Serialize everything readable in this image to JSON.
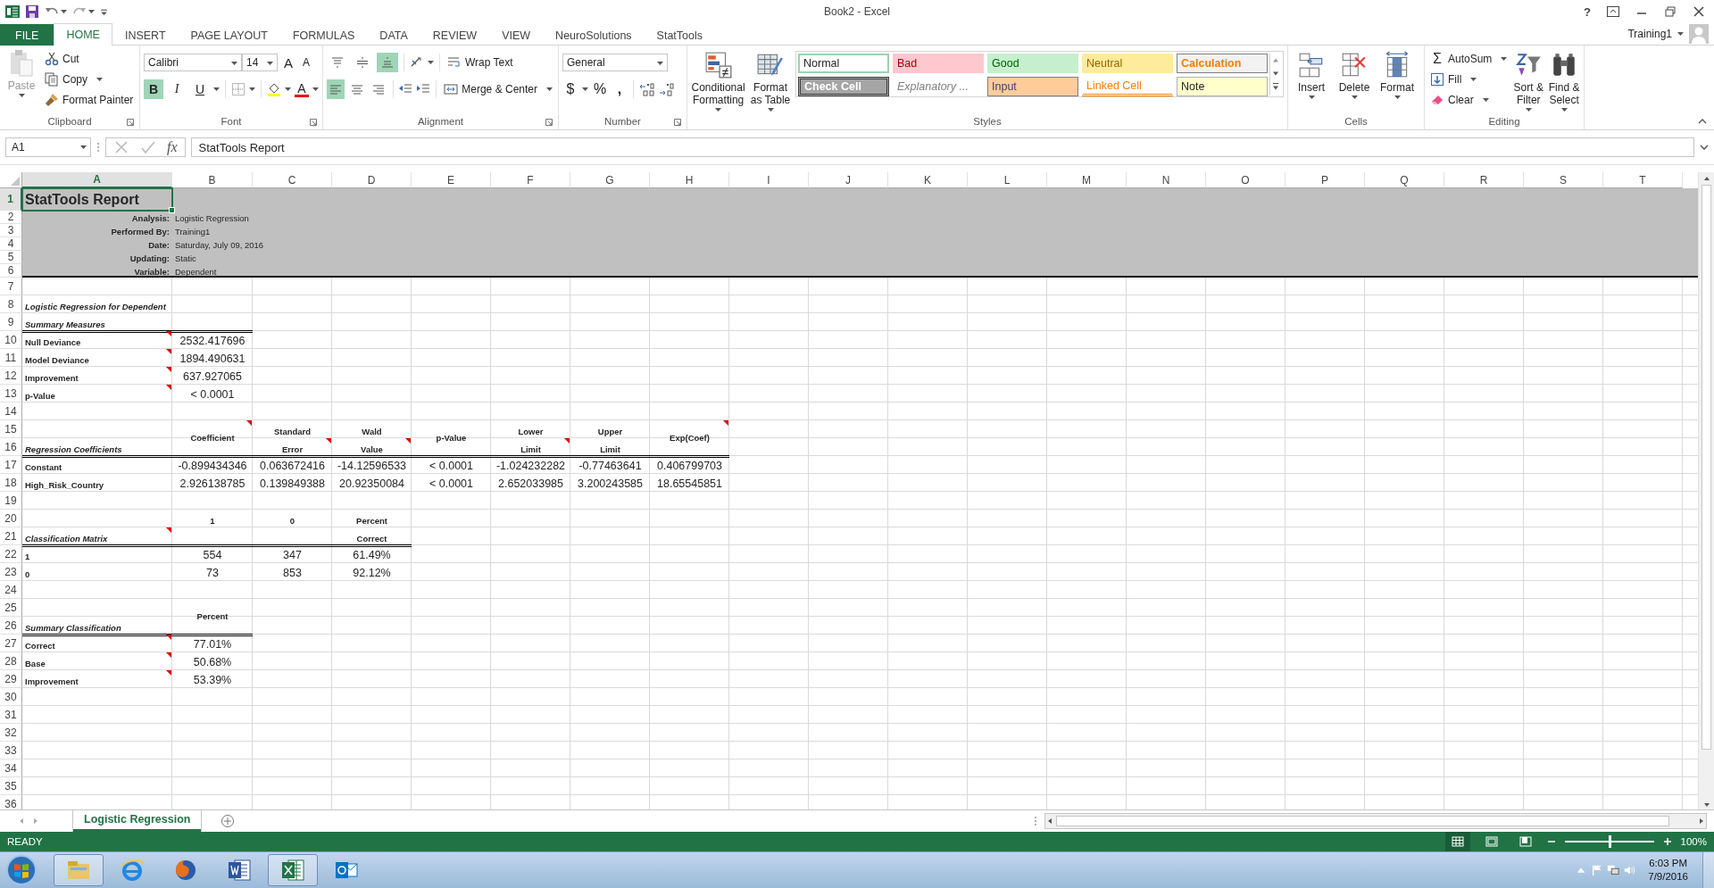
{
  "window": {
    "title": "Book2 - Excel",
    "help": "?",
    "user": "Training1"
  },
  "tabs": [
    {
      "label": "FILE",
      "kind": "file",
      "selected": false
    },
    {
      "label": "HOME",
      "kind": "tab",
      "selected": true
    },
    {
      "label": "INSERT",
      "kind": "tab",
      "selected": false
    },
    {
      "label": "PAGE LAYOUT",
      "kind": "tab",
      "selected": false
    },
    {
      "label": "FORMULAS",
      "kind": "tab",
      "selected": false
    },
    {
      "label": "DATA",
      "kind": "tab",
      "selected": false
    },
    {
      "label": "REVIEW",
      "kind": "tab",
      "selected": false
    },
    {
      "label": "VIEW",
      "kind": "tab",
      "selected": false
    },
    {
      "label": "NeuroSolutions",
      "kind": "tab",
      "selected": false
    },
    {
      "label": "StatTools",
      "kind": "tab",
      "selected": false
    }
  ],
  "ribbon": {
    "clipboard": {
      "label": "Clipboard",
      "paste": {
        "label": "Paste",
        "disabled": true
      },
      "cut": "Cut",
      "copy": "Copy",
      "format_painter": "Format Painter"
    },
    "font": {
      "label": "Font",
      "name": "Calibri",
      "size": "14",
      "grow": "A",
      "shrink": "A",
      "bold": {
        "glyph": "B",
        "selected": true
      },
      "italic": {
        "glyph": "I",
        "selected": false
      },
      "underline": {
        "glyph": "U",
        "selected": false
      },
      "font_color": "A"
    },
    "alignment": {
      "label": "Alignment",
      "wrap_text": "Wrap Text",
      "merge": "Merge & Center",
      "vertical": [
        {
          "kind": "top",
          "selected": false
        },
        {
          "kind": "middle",
          "selected": false
        },
        {
          "kind": "bottom",
          "selected": true
        }
      ],
      "horizontal": [
        {
          "kind": "left",
          "selected": true
        },
        {
          "kind": "center",
          "selected": false
        },
        {
          "kind": "right",
          "selected": false
        }
      ]
    },
    "number": {
      "label": "Number",
      "format": "General",
      "currency": "$",
      "percent": "%",
      "comma": ","
    },
    "styles": {
      "label": "Styles",
      "conditional": "Conditional Formatting",
      "format_table": "Format as Table",
      "gallery": [
        {
          "label": "Normal",
          "kind": "normal",
          "color": "#ffffff",
          "selected": true
        },
        {
          "label": "Bad",
          "kind": "bad",
          "color": "#ffc7ce",
          "selected": false
        },
        {
          "label": "Good",
          "kind": "good",
          "color": "#c6efce",
          "selected": false
        },
        {
          "label": "Neutral",
          "kind": "neutral",
          "color": "#ffeb9c",
          "selected": false
        },
        {
          "label": "Calculation",
          "kind": "calculation",
          "color": "#f2f2f2",
          "selected": false
        },
        {
          "label": "Check Cell",
          "kind": "check",
          "color": "#a5a5a5",
          "selected": false
        },
        {
          "label": "Explanatory ...",
          "kind": "explanatory",
          "color": "#ffffff",
          "selected": false
        },
        {
          "label": "Input",
          "kind": "input",
          "color": "#ffcc99",
          "selected": false
        },
        {
          "label": "Linked Cell",
          "kind": "linked",
          "color": "#ffffff",
          "selected": false
        },
        {
          "label": "Note",
          "kind": "note",
          "color": "#ffffcc",
          "selected": false
        }
      ]
    },
    "cells": {
      "label": "Cells",
      "buttons": [
        {
          "label": "Insert",
          "kind": "insert"
        },
        {
          "label": "Delete",
          "kind": "delete"
        },
        {
          "label": "Format",
          "kind": "format"
        }
      ]
    },
    "editing": {
      "label": "Editing",
      "sigma": "Σ",
      "autosum": "AutoSum",
      "fill": "Fill",
      "clear": "Clear",
      "sort": "Sort & Filter",
      "find": "Find & Select"
    }
  },
  "formula_bar": {
    "name_box": "A1",
    "function_label": "fx",
    "content": "StatTools Report"
  },
  "sheet": {
    "columns": [
      {
        "label": "A",
        "selected": true
      },
      {
        "label": "B",
        "selected": false
      },
      {
        "label": "C",
        "selected": false
      },
      {
        "label": "D",
        "selected": false
      },
      {
        "label": "E",
        "selected": false
      },
      {
        "label": "F",
        "selected": false
      },
      {
        "label": "G",
        "selected": false
      },
      {
        "label": "H",
        "selected": false
      },
      {
        "label": "I",
        "selected": false
      },
      {
        "label": "J",
        "selected": false
      },
      {
        "label": "K",
        "selected": false
      },
      {
        "label": "L",
        "selected": false
      },
      {
        "label": "M",
        "selected": false
      },
      {
        "label": "N",
        "selected": false
      },
      {
        "label": "O",
        "selected": false
      },
      {
        "label": "P",
        "selected": false
      },
      {
        "label": "Q",
        "selected": false
      },
      {
        "label": "R",
        "selected": false
      },
      {
        "label": "S",
        "selected": false
      },
      {
        "label": "T",
        "selected": false
      }
    ],
    "rows": [
      {
        "number": "1",
        "selected": true,
        "shaded": true,
        "cells": [
          {
            "text": "StatTools Report",
            "kind": "title",
            "selected": true
          }
        ]
      },
      {
        "number": "2",
        "selected": false,
        "shaded": true,
        "cells": [
          {
            "text": "Analysis:",
            "kind": "meta-label"
          },
          {
            "text": "Logistic Regression",
            "kind": "meta-value"
          }
        ]
      },
      {
        "number": "3",
        "selected": false,
        "shaded": true,
        "cells": [
          {
            "text": "Performed By:",
            "kind": "meta-label"
          },
          {
            "text": "Training1",
            "kind": "meta-value"
          }
        ]
      },
      {
        "number": "4",
        "selected": false,
        "shaded": true,
        "cells": [
          {
            "text": "Date:",
            "kind": "meta-label"
          },
          {
            "text": "Saturday, July 09, 2016",
            "kind": "meta-value"
          }
        ]
      },
      {
        "number": "5",
        "selected": false,
        "shaded": true,
        "cells": [
          {
            "text": "Updating:",
            "kind": "meta-label"
          },
          {
            "text": "Static",
            "kind": "meta-value"
          }
        ]
      },
      {
        "number": "6",
        "selected": false,
        "shaded": true,
        "cells": [
          {
            "text": "Variable:",
            "kind": "meta-label"
          },
          {
            "text": "Dependent",
            "kind": "meta-value"
          }
        ]
      },
      {
        "number": "7",
        "selected": false,
        "shaded": false
      },
      {
        "number": "8",
        "selected": false,
        "shaded": false,
        "cells": [
          {
            "text": "Logistic Regression for Dependent",
            "kind": "section"
          }
        ]
      },
      {
        "number": "9",
        "selected": false,
        "shaded": false,
        "cells": [
          {
            "text": "Summary Measures",
            "kind": "section",
            "rule": true
          },
          {
            "kind": "blank",
            "rule": true
          }
        ]
      },
      {
        "number": "10",
        "selected": false,
        "shaded": false,
        "cells": [
          {
            "text": "Null Deviance",
            "kind": "label",
            "comment": true
          },
          {
            "text": "2532.417696",
            "kind": "number"
          }
        ]
      },
      {
        "number": "11",
        "selected": false,
        "shaded": false,
        "cells": [
          {
            "text": "Model Deviance",
            "kind": "label",
            "comment": true
          },
          {
            "text": "1894.490631",
            "kind": "number"
          }
        ]
      },
      {
        "number": "12",
        "selected": false,
        "shaded": false,
        "cells": [
          {
            "text": "Improvement",
            "kind": "label",
            "comment": true
          },
          {
            "text": "637.927065",
            "kind": "number"
          }
        ]
      },
      {
        "number": "13",
        "selected": false,
        "shaded": false,
        "cells": [
          {
            "text": "p-Value",
            "kind": "label",
            "comment": true
          },
          {
            "text": "< 0.0001",
            "kind": "number"
          }
        ]
      },
      {
        "number": "14",
        "selected": false,
        "shaded": false
      },
      {
        "number": "15",
        "selected": false,
        "shaded": false,
        "cells": [
          {
            "kind": "blank"
          },
          {
            "text": "Coefficient",
            "kind": "head",
            "merged": true,
            "comment": true
          },
          {
            "text": "Standard",
            "kind": "head"
          },
          {
            "text": "Wald",
            "kind": "head"
          },
          {
            "text": "p-Value",
            "kind": "head",
            "merged": true
          },
          {
            "text": "Lower",
            "kind": "head"
          },
          {
            "text": "Upper",
            "kind": "head"
          },
          {
            "text": "Exp(Coef)",
            "kind": "head",
            "merged": true,
            "comment": true
          }
        ]
      },
      {
        "number": "16",
        "selected": false,
        "shaded": false,
        "cells": [
          {
            "text": "Regression Coefficients",
            "kind": "section",
            "rule": true
          },
          {
            "kind": "blank",
            "rule": true
          },
          {
            "text": "Error",
            "kind": "head",
            "rule": true,
            "comment": true
          },
          {
            "text": "Value",
            "kind": "head",
            "rule": true,
            "comment": true
          },
          {
            "kind": "blank",
            "rule": true
          },
          {
            "text": "Limit",
            "kind": "head",
            "rule": true,
            "comment": true
          },
          {
            "text": "Limit",
            "kind": "head",
            "rule": true
          },
          {
            "kind": "blank",
            "rule": true
          }
        ]
      },
      {
        "number": "17",
        "selected": false,
        "shaded": false,
        "cells": [
          {
            "text": "Constant",
            "kind": "label"
          },
          {
            "text": "-0.899434346",
            "kind": "number"
          },
          {
            "text": "0.063672416",
            "kind": "number"
          },
          {
            "text": "-14.12596533",
            "kind": "number"
          },
          {
            "text": "< 0.0001",
            "kind": "number"
          },
          {
            "text": "-1.024232282",
            "kind": "number"
          },
          {
            "text": "-0.77463641",
            "kind": "number"
          },
          {
            "text": "0.406799703",
            "kind": "number"
          }
        ]
      },
      {
        "number": "18",
        "selected": false,
        "shaded": false,
        "cells": [
          {
            "text": "High_Risk_Country",
            "kind": "label"
          },
          {
            "text": "2.926138785",
            "kind": "number"
          },
          {
            "text": "0.139849388",
            "kind": "number"
          },
          {
            "text": "20.92350084",
            "kind": "number"
          },
          {
            "text": "< 0.0001",
            "kind": "number"
          },
          {
            "text": "2.652033985",
            "kind": "number"
          },
          {
            "text": "3.200243585",
            "kind": "number"
          },
          {
            "text": "18.65545851",
            "kind": "number"
          }
        ]
      },
      {
        "number": "19",
        "selected": false,
        "shaded": false
      },
      {
        "number": "20",
        "selected": false,
        "shaded": false,
        "cells": [
          {
            "kind": "blank"
          },
          {
            "text": "1",
            "kind": "head"
          },
          {
            "text": "0",
            "kind": "head"
          },
          {
            "text": "Percent",
            "kind": "head"
          }
        ]
      },
      {
        "number": "21",
        "selected": false,
        "shaded": false,
        "cells": [
          {
            "text": "Classification Matrix",
            "kind": "section",
            "rule": true,
            "comment": true
          },
          {
            "kind": "blank",
            "rule": true
          },
          {
            "kind": "blank",
            "rule": true
          },
          {
            "text": "Correct",
            "kind": "head",
            "rule": true
          }
        ]
      },
      {
        "number": "22",
        "selected": false,
        "shaded": false,
        "cells": [
          {
            "text": "1",
            "kind": "label"
          },
          {
            "text": "554",
            "kind": "number"
          },
          {
            "text": "347",
            "kind": "number"
          },
          {
            "text": "61.49%",
            "kind": "number"
          }
        ]
      },
      {
        "number": "23",
        "selected": false,
        "shaded": false,
        "cells": [
          {
            "text": "0",
            "kind": "label"
          },
          {
            "text": "73",
            "kind": "number"
          },
          {
            "text": "853",
            "kind": "number"
          },
          {
            "text": "92.12%",
            "kind": "number"
          }
        ]
      },
      {
        "number": "24",
        "selected": false,
        "shaded": false
      },
      {
        "number": "25",
        "selected": false,
        "shaded": false,
        "cells": [
          {
            "kind": "blank"
          },
          {
            "text": "Percent",
            "kind": "head",
            "merged": true
          }
        ]
      },
      {
        "number": "26",
        "selected": false,
        "shaded": false,
        "cells": [
          {
            "text": "Summary Classification",
            "kind": "section",
            "rule": true
          },
          {
            "kind": "blank",
            "rule": true
          }
        ]
      },
      {
        "number": "27",
        "selected": false,
        "shaded": false,
        "cells": [
          {
            "text": "Correct",
            "kind": "label",
            "comment": true
          },
          {
            "text": "77.01%",
            "kind": "number"
          }
        ]
      },
      {
        "number": "28",
        "selected": false,
        "shaded": false,
        "cells": [
          {
            "text": "Base",
            "kind": "label",
            "comment": true
          },
          {
            "text": "50.68%",
            "kind": "number"
          }
        ]
      },
      {
        "number": "29",
        "selected": false,
        "shaded": false,
        "cells": [
          {
            "text": "Improvement",
            "kind": "label",
            "comment": true
          },
          {
            "text": "53.39%",
            "kind": "number"
          }
        ]
      },
      {
        "number": "30",
        "selected": false,
        "shaded": false
      },
      {
        "number": "31",
        "selected": false,
        "shaded": false
      },
      {
        "number": "32",
        "selected": false,
        "shaded": false
      },
      {
        "number": "33",
        "selected": false,
        "shaded": false
      },
      {
        "number": "34",
        "selected": false,
        "shaded": false
      },
      {
        "number": "35",
        "selected": false,
        "shaded": false
      },
      {
        "number": "36",
        "selected": false,
        "shaded": false
      }
    ]
  },
  "sheet_tabs": [
    {
      "label": "Logistic Regression",
      "selected": true
    }
  ],
  "status_bar": {
    "mode": "READY",
    "views": [
      {
        "kind": "normal",
        "selected": true
      },
      {
        "kind": "layout",
        "selected": false
      },
      {
        "kind": "pagebreak",
        "selected": false
      }
    ],
    "zoom_slider": {
      "level": 0.5
    },
    "zoom": "100%"
  },
  "taskbar": {
    "apps": [
      {
        "kind": "explorer",
        "running": true
      },
      {
        "kind": "browser",
        "running": false
      },
      {
        "kind": "firefox",
        "running": false
      },
      {
        "kind": "word",
        "running": false
      },
      {
        "kind": "excel",
        "running": true
      },
      {
        "kind": "outlook",
        "running": false
      }
    ],
    "time": "6:03 PM",
    "date": "7/9/2016"
  }
}
